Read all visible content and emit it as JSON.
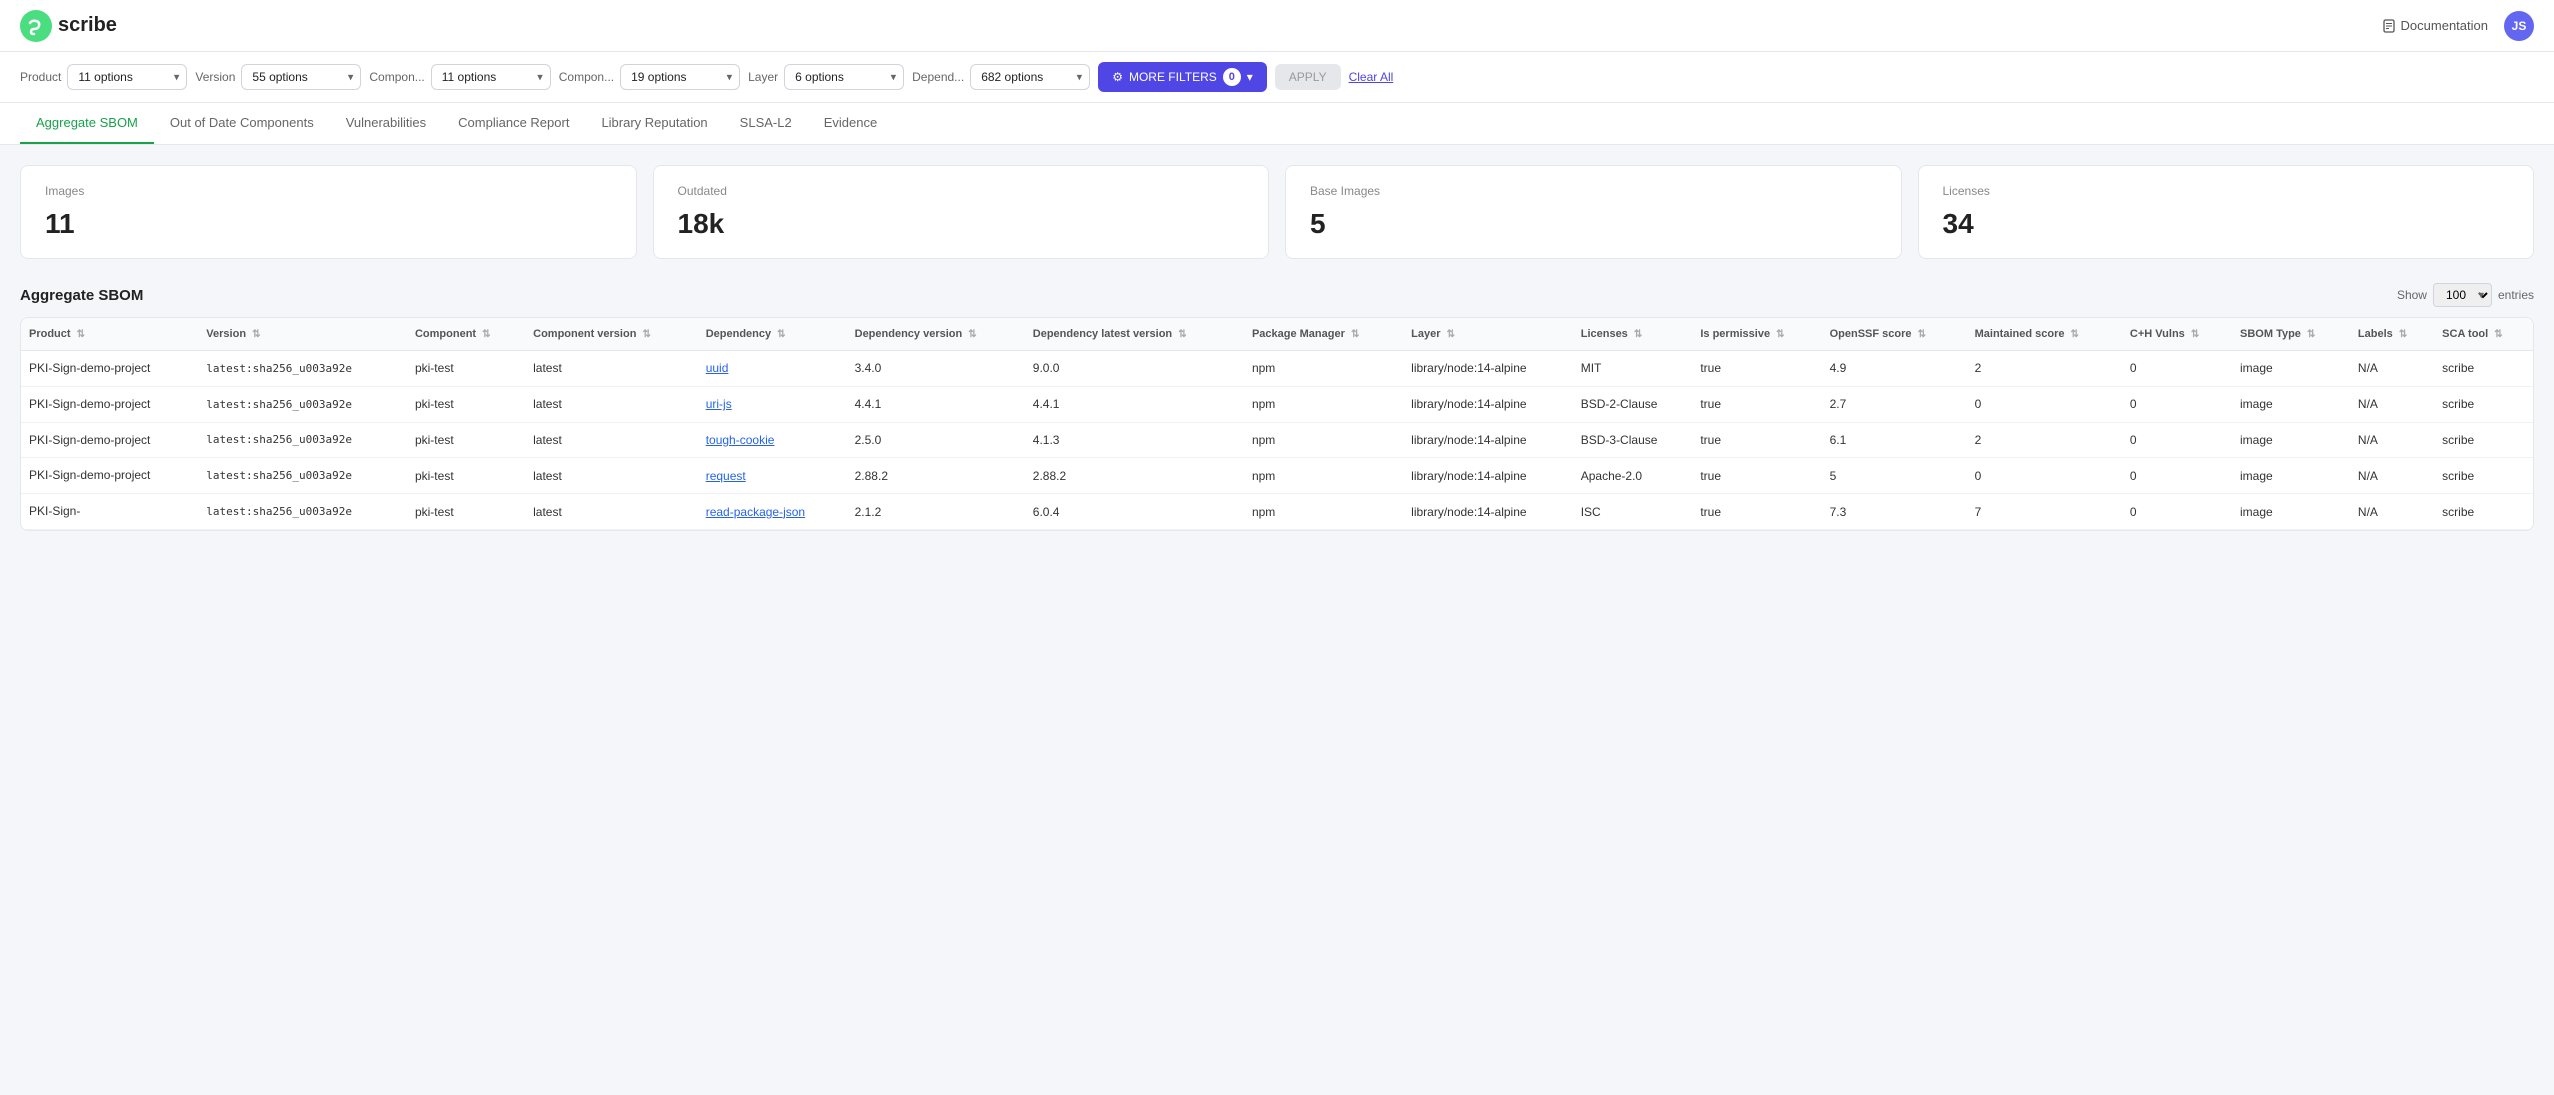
{
  "app": {
    "name": "scribe",
    "logo_letter": "S"
  },
  "header": {
    "doc_link": "Documentation",
    "avatar_initials": "JS"
  },
  "filters": {
    "product_label": "Product",
    "product_value": "11 options",
    "version_label": "Version",
    "version_value": "55 options",
    "component_label": "Compon...",
    "component_value": "11 options",
    "component2_label": "Compon...",
    "component2_value": "19 options",
    "layer_label": "Layer",
    "layer_value": "6 options",
    "depend_label": "Depend...",
    "depend_value": "682 options",
    "more_filters_label": "MORE FILTERS",
    "more_filters_count": "0",
    "apply_label": "APPLY",
    "clear_all_label": "Clear All"
  },
  "tabs": [
    {
      "label": "Aggregate SBOM",
      "active": true
    },
    {
      "label": "Out of Date Components",
      "active": false
    },
    {
      "label": "Vulnerabilities",
      "active": false
    },
    {
      "label": "Compliance Report",
      "active": false
    },
    {
      "label": "Library Reputation",
      "active": false
    },
    {
      "label": "SLSA-L2",
      "active": false
    },
    {
      "label": "Evidence",
      "active": false
    }
  ],
  "summary_cards": [
    {
      "title": "Images",
      "value": "11"
    },
    {
      "title": "Outdated",
      "value": "18k"
    },
    {
      "title": "Base Images",
      "value": "5"
    },
    {
      "title": "Licenses",
      "value": "34"
    }
  ],
  "table": {
    "title": "Aggregate SBOM",
    "show_label": "Show",
    "show_value": "100",
    "entries_label": "entries",
    "columns": [
      "Product",
      "Version",
      "Component",
      "Component version",
      "Dependency",
      "Dependency version",
      "Dependency latest version",
      "Package Manager",
      "Layer",
      "Licenses",
      "Is permissive",
      "OpenSSF score",
      "Maintained score",
      "C+H Vulns",
      "SBOM Type",
      "Labels",
      "SCA tool"
    ],
    "rows": [
      {
        "product": "PKI-Sign-demo-project",
        "version": "latest:sha256_u003a92e",
        "component": "pki-test",
        "comp_version": "latest",
        "dependency": "uuid",
        "dep_version": "3.4.0",
        "dep_latest": "9.0.0",
        "pkg_manager": "npm",
        "layer": "library/node:14-alpine",
        "licenses": "MIT",
        "is_permissive": "true",
        "openssf": "4.9",
        "maintained": "2",
        "ch_vulns": "0",
        "sbom_type": "image",
        "labels": "N/A",
        "sca_tool": "scribe"
      },
      {
        "product": "PKI-Sign-demo-project",
        "version": "latest:sha256_u003a92e",
        "component": "pki-test",
        "comp_version": "latest",
        "dependency": "uri-js",
        "dep_version": "4.4.1",
        "dep_latest": "4.4.1",
        "pkg_manager": "npm",
        "layer": "library/node:14-alpine",
        "licenses": "BSD-2-Clause",
        "is_permissive": "true",
        "openssf": "2.7",
        "maintained": "0",
        "ch_vulns": "0",
        "sbom_type": "image",
        "labels": "N/A",
        "sca_tool": "scribe"
      },
      {
        "product": "PKI-Sign-demo-project",
        "version": "latest:sha256_u003a92e",
        "component": "pki-test",
        "comp_version": "latest",
        "dependency": "tough-cookie",
        "dep_version": "2.5.0",
        "dep_latest": "4.1.3",
        "pkg_manager": "npm",
        "layer": "library/node:14-alpine",
        "licenses": "BSD-3-Clause",
        "is_permissive": "true",
        "openssf": "6.1",
        "maintained": "2",
        "ch_vulns": "0",
        "sbom_type": "image",
        "labels": "N/A",
        "sca_tool": "scribe"
      },
      {
        "product": "PKI-Sign-demo-project",
        "version": "latest:sha256_u003a92e",
        "component": "pki-test",
        "comp_version": "latest",
        "dependency": "request",
        "dep_version": "2.88.2",
        "dep_latest": "2.88.2",
        "pkg_manager": "npm",
        "layer": "library/node:14-alpine",
        "licenses": "Apache-2.0",
        "is_permissive": "true",
        "openssf": "5",
        "maintained": "0",
        "ch_vulns": "0",
        "sbom_type": "image",
        "labels": "N/A",
        "sca_tool": "scribe"
      },
      {
        "product": "PKI-Sign-",
        "version": "latest:sha256_u003a92e",
        "component": "pki-test",
        "comp_version": "latest",
        "dependency": "read-package-json",
        "dep_version": "2.1.2",
        "dep_latest": "6.0.4",
        "pkg_manager": "npm",
        "layer": "library/node:14-alpine",
        "licenses": "ISC",
        "is_permissive": "true",
        "openssf": "7.3",
        "maintained": "7",
        "ch_vulns": "0",
        "sbom_type": "image",
        "labels": "N/A",
        "sca_tool": "scribe"
      }
    ]
  }
}
